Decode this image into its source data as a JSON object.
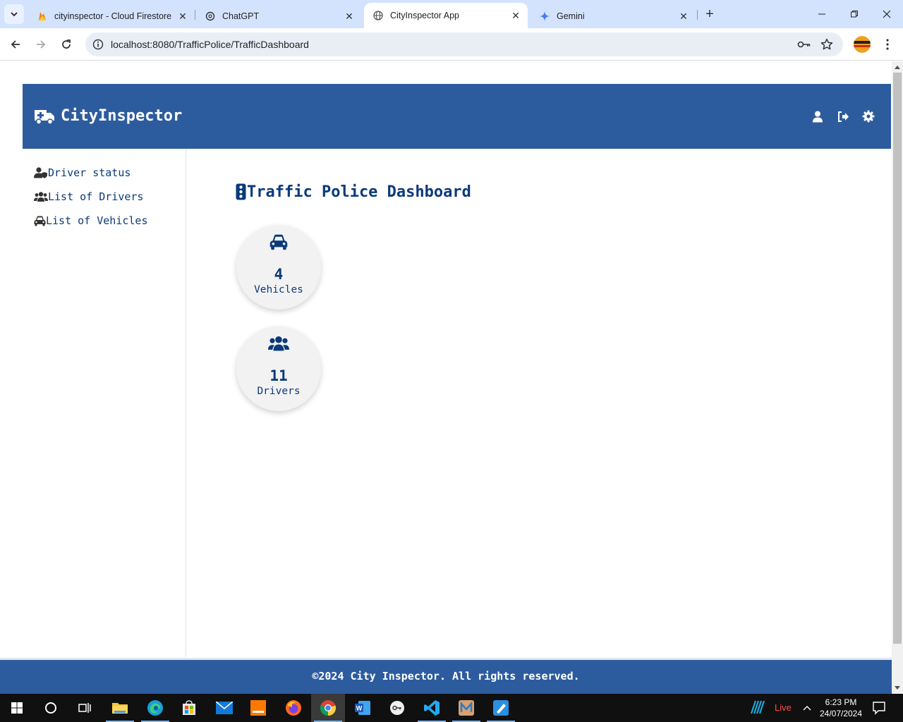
{
  "browser": {
    "tabs": [
      {
        "title": "cityinspector - Cloud Firestore"
      },
      {
        "title": "ChatGPT"
      },
      {
        "title": "CityInspector App"
      },
      {
        "title": "Gemini"
      }
    ],
    "url": "localhost:8080/TrafficPolice/TrafficDashboard"
  },
  "app": {
    "brand": "CityInspector",
    "sidebar": {
      "items": [
        {
          "label": "Driver status",
          "icon": "user-shield-icon"
        },
        {
          "label": "List of Drivers",
          "icon": "users-icon"
        },
        {
          "label": "List of Vehicles",
          "icon": "car-icon"
        }
      ]
    },
    "main": {
      "title": "Traffic Police Dashboard",
      "stats": [
        {
          "value": "4",
          "label": "Vehicles",
          "icon": "car-icon"
        },
        {
          "value": "11",
          "label": "Drivers",
          "icon": "users-icon"
        }
      ]
    },
    "footer": "©2024 City Inspector. All rights reserved."
  },
  "colors": {
    "header": "#2d5c9e",
    "text_primary": "#0a3a7a",
    "tabstrip": "#d3e3fd"
  },
  "taskbar": {
    "live_label": "Live",
    "time": "6:23 PM",
    "date": "24/07/2024"
  }
}
